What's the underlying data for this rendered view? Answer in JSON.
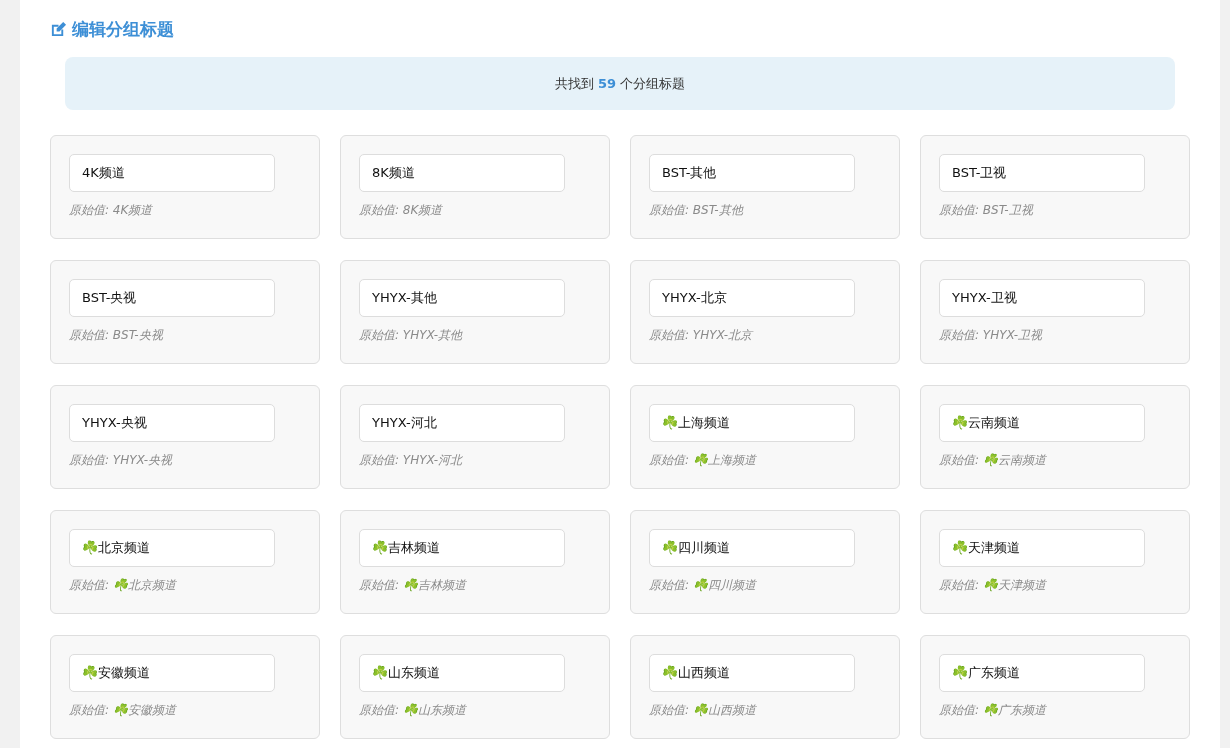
{
  "title": "编辑分组标题",
  "summary": "共找到 **59** 个分组标题",
  "groups": [
    {
      "value": "4K频道",
      "original": "原始值: 4K频道"
    },
    {
      "value": "8K频道",
      "original": "原始值: 8K频道"
    },
    {
      "value": "BST-其他",
      "original": "原始值: BST-其他"
    },
    {
      "value": "BST-卫视",
      "original": "原始值: BST-卫视"
    },
    {
      "value": "BST-央视",
      "original": "原始值: BST-央视"
    },
    {
      "value": "YHYX-其他",
      "original": "原始值: YHYX-其他"
    },
    {
      "value": "YHYX-北京",
      "original": "原始值: YHYX-北京"
    },
    {
      "value": "YHYX-卫视",
      "original": "原始值: YHYX-卫视"
    },
    {
      "value": "YHYX-央视",
      "original": "原始值: YHYX-央视"
    },
    {
      "value": "YHYX-河北",
      "original": "原始值: YHYX-河北"
    },
    {
      "value": "☘️上海频道",
      "original": "原始值: ☘️上海频道"
    },
    {
      "value": "☘️云南频道",
      "original": "原始值: ☘️云南频道"
    },
    {
      "value": "☘️北京频道",
      "original": "原始值: ☘️北京频道"
    },
    {
      "value": "☘️吉林频道",
      "original": "原始值: ☘️吉林频道"
    },
    {
      "value": "☘️四川频道",
      "original": "原始值: ☘️四川频道"
    },
    {
      "value": "☘️天津频道",
      "original": "原始值: ☘️天津频道"
    },
    {
      "value": "☘️安徽频道",
      "original": "原始值: ☘️安徽频道"
    },
    {
      "value": "☘️山东频道",
      "original": "原始值: ☘️山东频道"
    },
    {
      "value": "☘️山西频道",
      "original": "原始值: ☘️山西频道"
    },
    {
      "value": "☘️广东频道",
      "original": "原始值: ☘️广东频道"
    }
  ]
}
